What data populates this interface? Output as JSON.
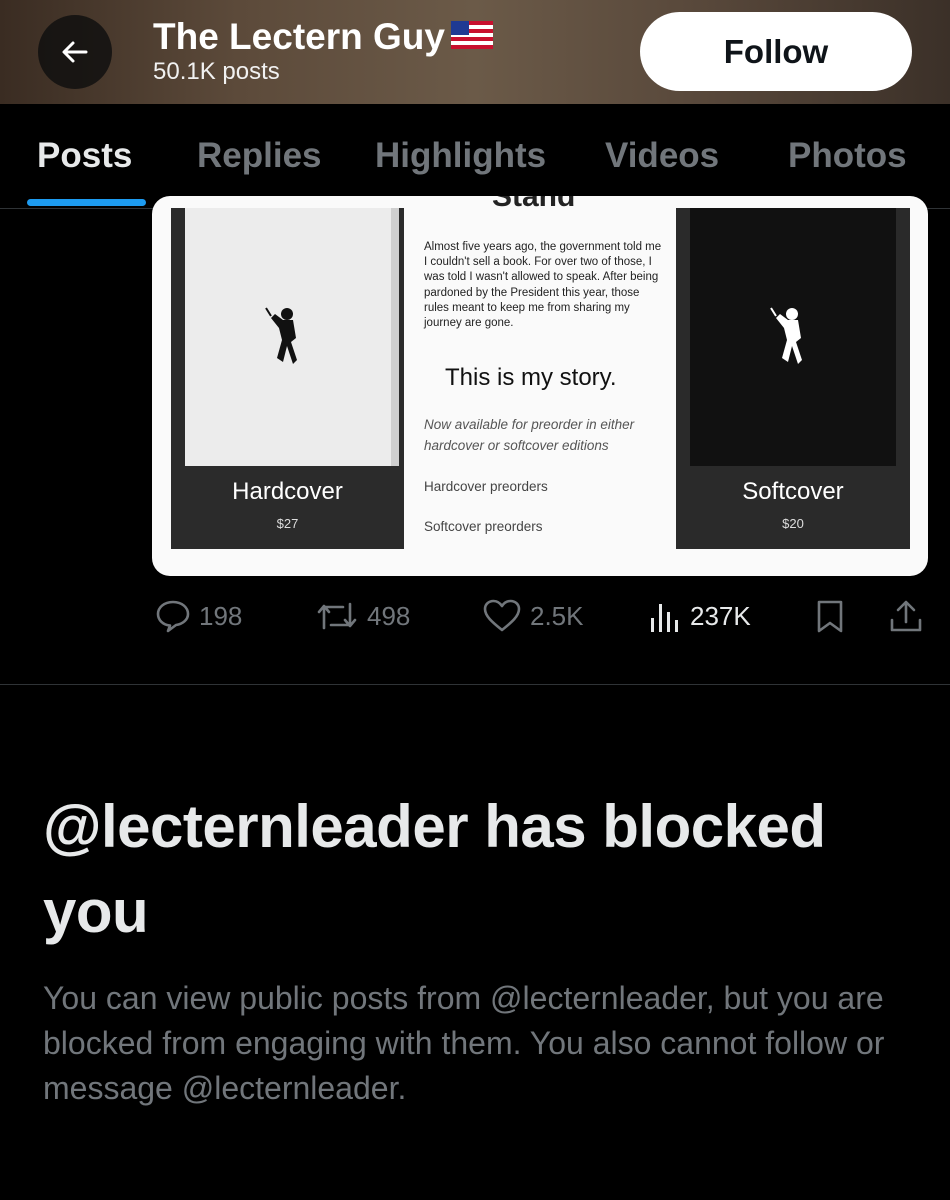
{
  "header": {
    "back_icon": "arrow-left-icon",
    "title": "The Lectern Guy",
    "flag_icon": "us-flag-icon",
    "subtitle": "50.1K posts",
    "follow_label": "Follow"
  },
  "tabs": [
    {
      "label": "Posts",
      "active": true
    },
    {
      "label": "Replies",
      "active": false
    },
    {
      "label": "Highlights",
      "active": false
    },
    {
      "label": "Videos",
      "active": false
    },
    {
      "label": "Photos",
      "active": false
    }
  ],
  "media": {
    "partial_heading": "Stand",
    "paragraph": "Almost five years ago, the government told me I couldn't sell a book. For over two of those, I was told I wasn't allowed to speak. After being pardoned by the President this year, those rules meant to keep me from sharing my journey are gone.",
    "story_heading": "This is my story.",
    "availability": "Now available for preorder in either hardcover or softcover editions",
    "hardcover_preorders": "Hardcover preorders",
    "softcover_preorders": "Softcover preorders",
    "hardcover": {
      "label": "Hardcover",
      "price": "$27"
    },
    "softcover": {
      "label": "Softcover",
      "price": "$20"
    }
  },
  "actions": {
    "replies": "198",
    "reposts": "498",
    "likes": "2.5K",
    "views": "237K"
  },
  "blocked": {
    "title": "@lecternleader has blocked you",
    "body": "You can view public posts from @lecternleader, but you are blocked from engaging with them. You also cannot follow or message @lecternleader."
  },
  "colors": {
    "accent": "#1d9bf0",
    "background": "#000000",
    "muted_text": "#71767b"
  }
}
